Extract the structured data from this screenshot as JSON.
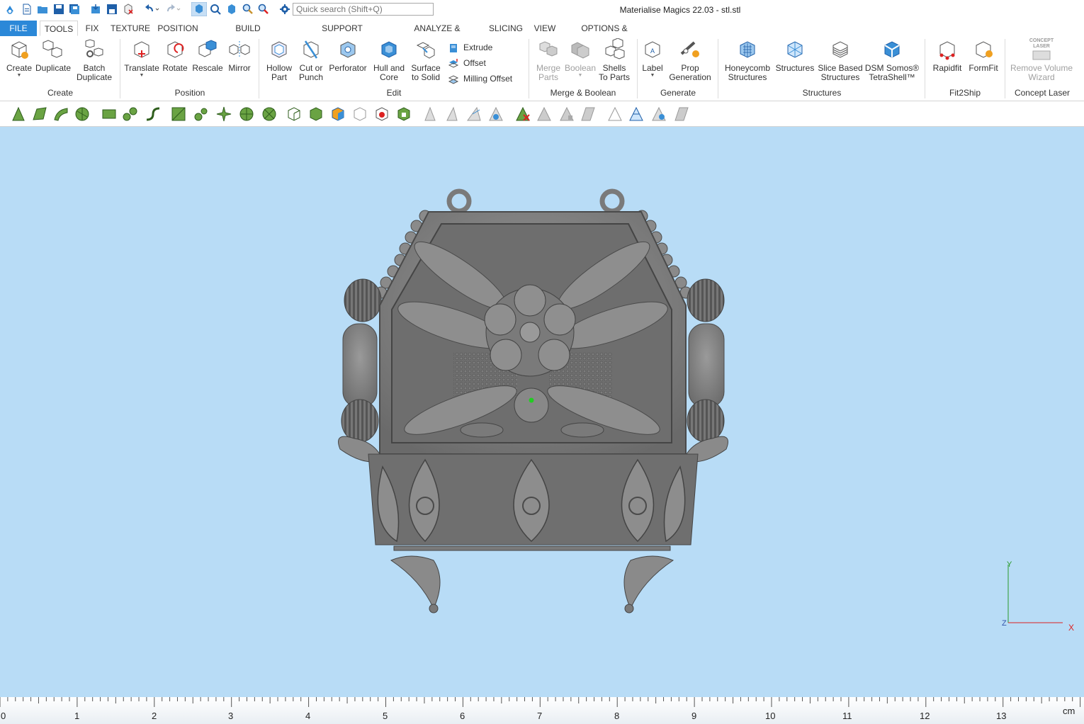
{
  "window": {
    "title": "Materialise Magics 22.03 - stl.stl"
  },
  "search": {
    "placeholder": "Quick search (Shift+Q)"
  },
  "tabs": [
    {
      "label": "FILE"
    },
    {
      "label": "TOOLS"
    },
    {
      "label": "FIX"
    },
    {
      "label": "TEXTURE"
    },
    {
      "label": "POSITION"
    },
    {
      "label": "BUILD PREPARATION"
    },
    {
      "label": "SUPPORT GENERATION"
    },
    {
      "label": "ANALYZE & REPORT"
    },
    {
      "label": "SLICING"
    },
    {
      "label": "VIEW"
    },
    {
      "label": "OPTIONS & HELP"
    }
  ],
  "ribbon": {
    "create": {
      "label": "Create",
      "create": "Create",
      "duplicate": "Duplicate",
      "batch1": "Batch",
      "batch2": "Duplicate"
    },
    "position": {
      "label": "Position",
      "translate": "Translate",
      "rotate": "Rotate",
      "rescale": "Rescale",
      "mirror": "Mirror"
    },
    "edit": {
      "label": "Edit",
      "hollow1": "Hollow",
      "hollow2": "Part",
      "cut1": "Cut or",
      "cut2": "Punch",
      "perforator": "Perforator",
      "hull1": "Hull and",
      "hull2": "Core",
      "surface1": "Surface",
      "surface2": "to Solid",
      "extrude": "Extrude",
      "offset": "Offset",
      "milling": "Milling Offset"
    },
    "merge": {
      "label": "Merge & Boolean",
      "merge1": "Merge",
      "merge2": "Parts",
      "boolean": "Boolean",
      "shells1": "Shells",
      "shells2": "To Parts"
    },
    "generate": {
      "label": "Generate",
      "label_btn": "Label",
      "prop1": "Prop",
      "prop2": "Generation"
    },
    "structures": {
      "label": "Structures",
      "honey1": "Honeycomb",
      "honey2": "Structures",
      "structures": "Structures",
      "slice1": "Slice Based",
      "slice2": "Structures",
      "dsm1": "DSM Somos®",
      "dsm2": "TetraShell™"
    },
    "fit2ship": {
      "label": "Fit2Ship",
      "rapidfit": "Rapidfit",
      "formfit": "FormFit"
    },
    "concept": {
      "label": "Concept Laser",
      "logo1": "CONCEPT",
      "logo2": "LASER",
      "remove1": "Remove Volume",
      "remove2": "Wizard"
    }
  },
  "viewport": {
    "background": "#b8dcf6",
    "axis_y": "Y",
    "axis_z": "Z",
    "axis_x": "X"
  },
  "ruler": {
    "unit": "cm",
    "numbers": [
      "0",
      "1",
      "2",
      "3",
      "4",
      "5",
      "6",
      "7",
      "8",
      "9",
      "10",
      "11",
      "12",
      "13"
    ]
  },
  "colors": {
    "accent": "#2b88d8",
    "icon_blue": "#3a8fd6",
    "icon_green": "#6aa343"
  }
}
